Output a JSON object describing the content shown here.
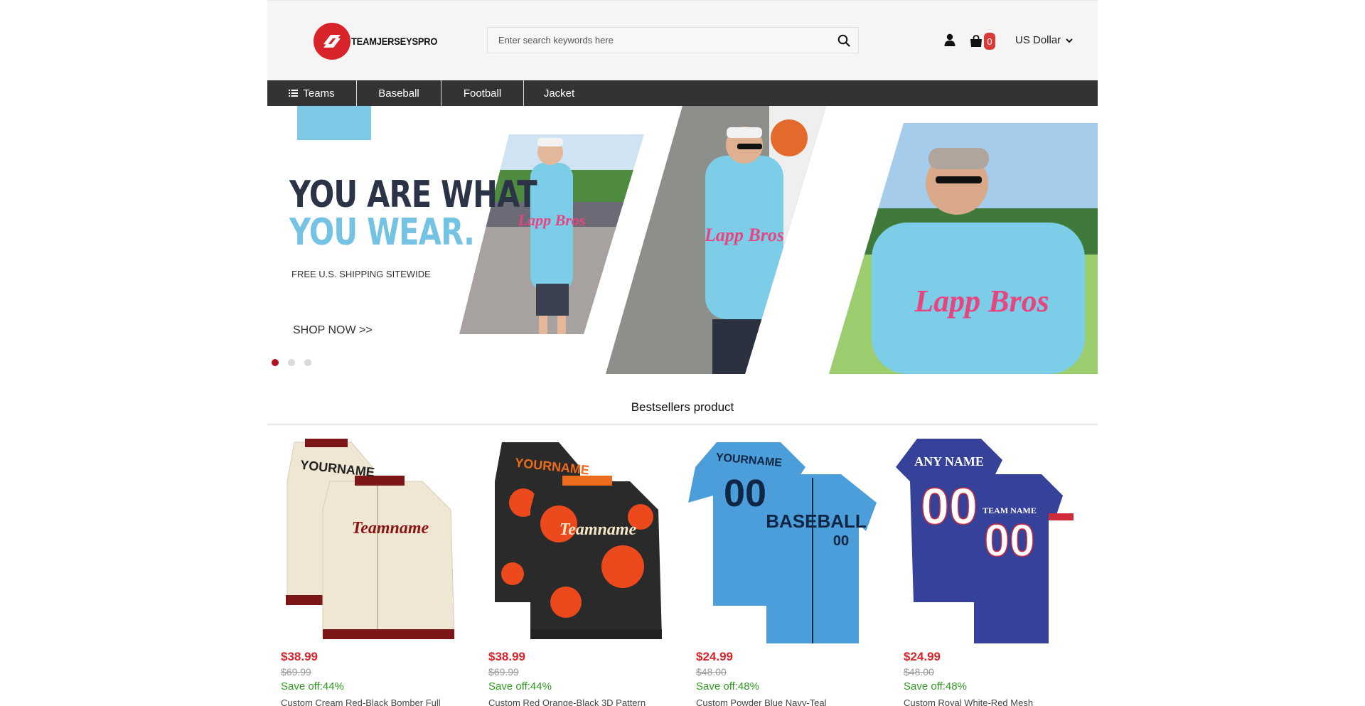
{
  "header": {
    "logo_text": "TEAMJERSEYSPRO",
    "search_placeholder": "Enter search keywords here",
    "cart_count": "0",
    "currency": "US Dollar"
  },
  "nav": {
    "items": [
      {
        "label": "Teams"
      },
      {
        "label": "Baseball"
      },
      {
        "label": "Football"
      },
      {
        "label": "Jacket"
      }
    ]
  },
  "banner": {
    "headline_line1": "YOU ARE WHAT",
    "headline_line2": "YOU WEAR.",
    "subtext": "FREE U.S. SHIPPING SITEWIDE",
    "cta": "SHOP NOW >>",
    "jersey_text": "Lapp Bros",
    "slides_total": 3,
    "active_slide": 1
  },
  "section": {
    "title": "Bestsellers product"
  },
  "products": [
    {
      "price": "$38.99",
      "old_price": "$69.99",
      "save": "Save off:44%",
      "name": "Custom Cream Red-Black Bomber Full",
      "color_a": "#efe6d4",
      "color_b": "#8a1414",
      "label_top": "YOURNAME",
      "label_mid": "Teamname"
    },
    {
      "price": "$38.99",
      "old_price": "$69.99",
      "save": "Save off:44%",
      "name": "Custom Red Orange-Black 3D Pattern",
      "color_a": "#2a2a2a",
      "color_b": "#ec4a1c",
      "label_top": "YOURNAME",
      "label_mid": "Teamname"
    },
    {
      "price": "$24.99",
      "old_price": "$48.00",
      "save": "Save off:48%",
      "name": "Custom Powder Blue Navy-Teal",
      "color_a": "#4c9edb",
      "color_b": "#0f2744",
      "label_top": "YOURNAME",
      "label_mid": "BASEBALL"
    },
    {
      "price": "$24.99",
      "old_price": "$48.00",
      "save": "Save off:48%",
      "name": "Custom Royal White-Red Mesh",
      "color_a": "#36419a",
      "color_b": "#ffffff",
      "label_top": "ANY NAME",
      "label_mid": "TEAM NAME"
    }
  ]
}
